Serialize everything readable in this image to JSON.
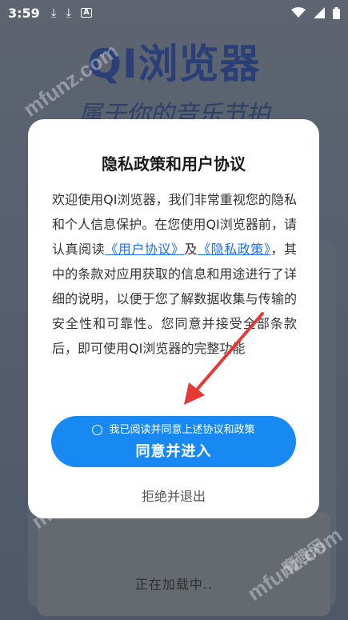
{
  "status_bar": {
    "time": "3:59",
    "icons": [
      "download-icon",
      "download-icon",
      "a-box-icon",
      "wifi-icon",
      "signal-icon",
      "battery-icon"
    ]
  },
  "background": {
    "app_title": "QI浏览器",
    "slogan": "属于你的音乐节拍",
    "loading_text": "正在加载中..",
    "watermark_text": "mfunz.com",
    "watermark_brand": "魔趣网"
  },
  "dialog": {
    "title": "隐私政策和用户协议",
    "body_part1": "欢迎使用QI浏览器，我们非常重视您的隐私和个人信息保护。在您使用QI浏览器前，请认真阅读",
    "user_agreement_link": "《用户协议》",
    "conjunction": "及",
    "privacy_policy_link": "《隐私政策》",
    "body_part2": "，其中的条款对应用获取的信息和用途进行了详细的说明，以便于您了解数据收集与传输的安全性和可靠性。您同意并接受全部条款后，即可使用QI浏览器的完整功能",
    "consent_text": "我已阅读并同意上述协议和政策",
    "consent_checked": false,
    "agree_button_label": "同意并进入",
    "reject_button_label": "拒绝并退出"
  },
  "colors": {
    "primary_button": "#1889f3",
    "link": "#1d6ef5",
    "annotation_arrow": "#e53935"
  }
}
